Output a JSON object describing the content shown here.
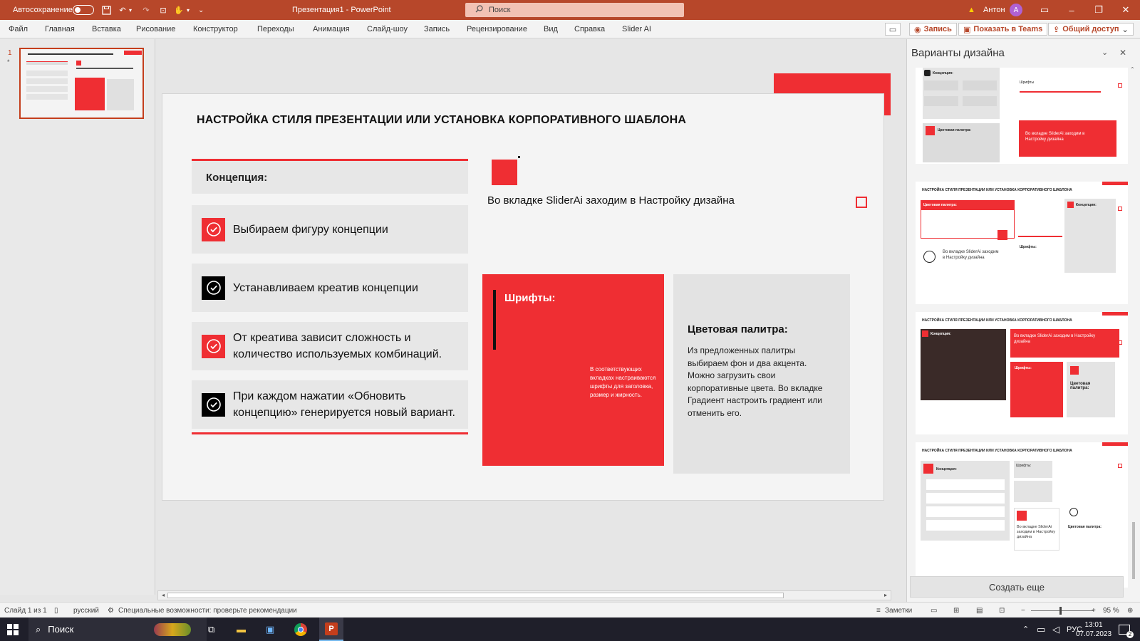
{
  "titlebar": {
    "autosave": "Автосохранение",
    "doc_title": "Презентация1 - PowerPoint",
    "search_placeholder": "Поиск",
    "user": "Антон",
    "avatar_letter": "А"
  },
  "menu": {
    "tabs": [
      "Файл",
      "Главная",
      "Вставка",
      "Рисование",
      "Конструктор",
      "Переходы",
      "Анимация",
      "Слайд-шоу",
      "Запись",
      "Рецензирование",
      "Вид",
      "Справка",
      "Slider AI"
    ],
    "record": "Запись",
    "teams": "Показать в Teams",
    "share": "Общий доступ"
  },
  "thumbs": {
    "number": "1",
    "star": "*"
  },
  "slide": {
    "title": "НАСТРОЙКА СТИЛЯ ПРЕЗЕНТАЦИИ ИЛИ УСТАНОВКА КОРПОРАТИВНОГО ШАБЛОНА",
    "concept_label": "Концепция:",
    "items": [
      {
        "text": "Выбираем фигуру концепции",
        "style": "red"
      },
      {
        "text": "Устанавливаем креатив концепции",
        "style": "black"
      },
      {
        "text": "От креатива зависит сложность и количество используемых комбинаций.",
        "style": "red"
      },
      {
        "text": "При каждом нажатии «Обновить концепцию» генерируется новый вариант.",
        "style": "black"
      }
    ],
    "tab_note": "Во вкладке SliderAi заходим в Настройку дизайна",
    "fonts_title": "Шрифты:",
    "fonts_text": "В соответствующих вкладках настраиваются шрифты для заголовка, размер и жирность.",
    "palette_title": "Цветовая палитра:",
    "palette_text": "Из предложенных палитры выбираем фон и два акцента. Можно загрузить свои корпоративные цвета. Во вкладке Градиент настроить градиент или отменить его."
  },
  "design_pane": {
    "title": "Варианты дизайна",
    "create_more": "Создать еще",
    "v1": {
      "concept": "Концепция:",
      "fonts": "Шрифты",
      "palette": "Цветовая палитра:",
      "note": "Во вкладке SliderAi заходим в Настройку дизайна"
    },
    "v2": {
      "title": "НАСТРОЙКА СТИЛЯ ПРЕЗЕНТАЦИИ ИЛИ УСТАНОВКА КОРПОРАТИВНОГО ШАБЛОНА",
      "palette": "Цветовая палитра:",
      "note": "Во вкладке SliderAi заходим в Настройку дизайна",
      "fonts": "Шрифты:",
      "concept": "Концепция:"
    },
    "v3": {
      "title": "НАСТРОЙКА СТИЛЯ ПРЕЗЕНТАЦИИ ИЛИ УСТАНОВКА КОРПОРАТИВНОГО ШАБЛОНА",
      "concept": "Концепция:",
      "note": "Во вкладке SliderAi заходим в Настройку дизайна",
      "fonts": "Шрифты:",
      "palette": "Цветовая палитра:"
    },
    "v4": {
      "title": "НАСТРОЙКА СТИЛЯ ПРЕЗЕНТАЦИИ ИЛИ УСТАНОВКА КОРПОРАТИВНОГО ШАБЛОНА",
      "concept": "Концепция:",
      "fonts": "Шрифты:",
      "note": "Во вкладке SliderAi заходим в Настройку дизайна",
      "palette": "Цветовая палитра:"
    }
  },
  "status": {
    "slide": "Слайд 1 из 1",
    "lang": "русский",
    "accessibility": "Специальные возможности: проверьте рекомендации",
    "notes": "Заметки",
    "zoom": "95 %"
  },
  "taskbar": {
    "search": "Поиск",
    "lang": "РУС",
    "time": "13:01",
    "date": "07.07.2023",
    "notif": "2"
  },
  "colors": {
    "accent": "#ef2e33",
    "titlebar": "#b7472a"
  }
}
